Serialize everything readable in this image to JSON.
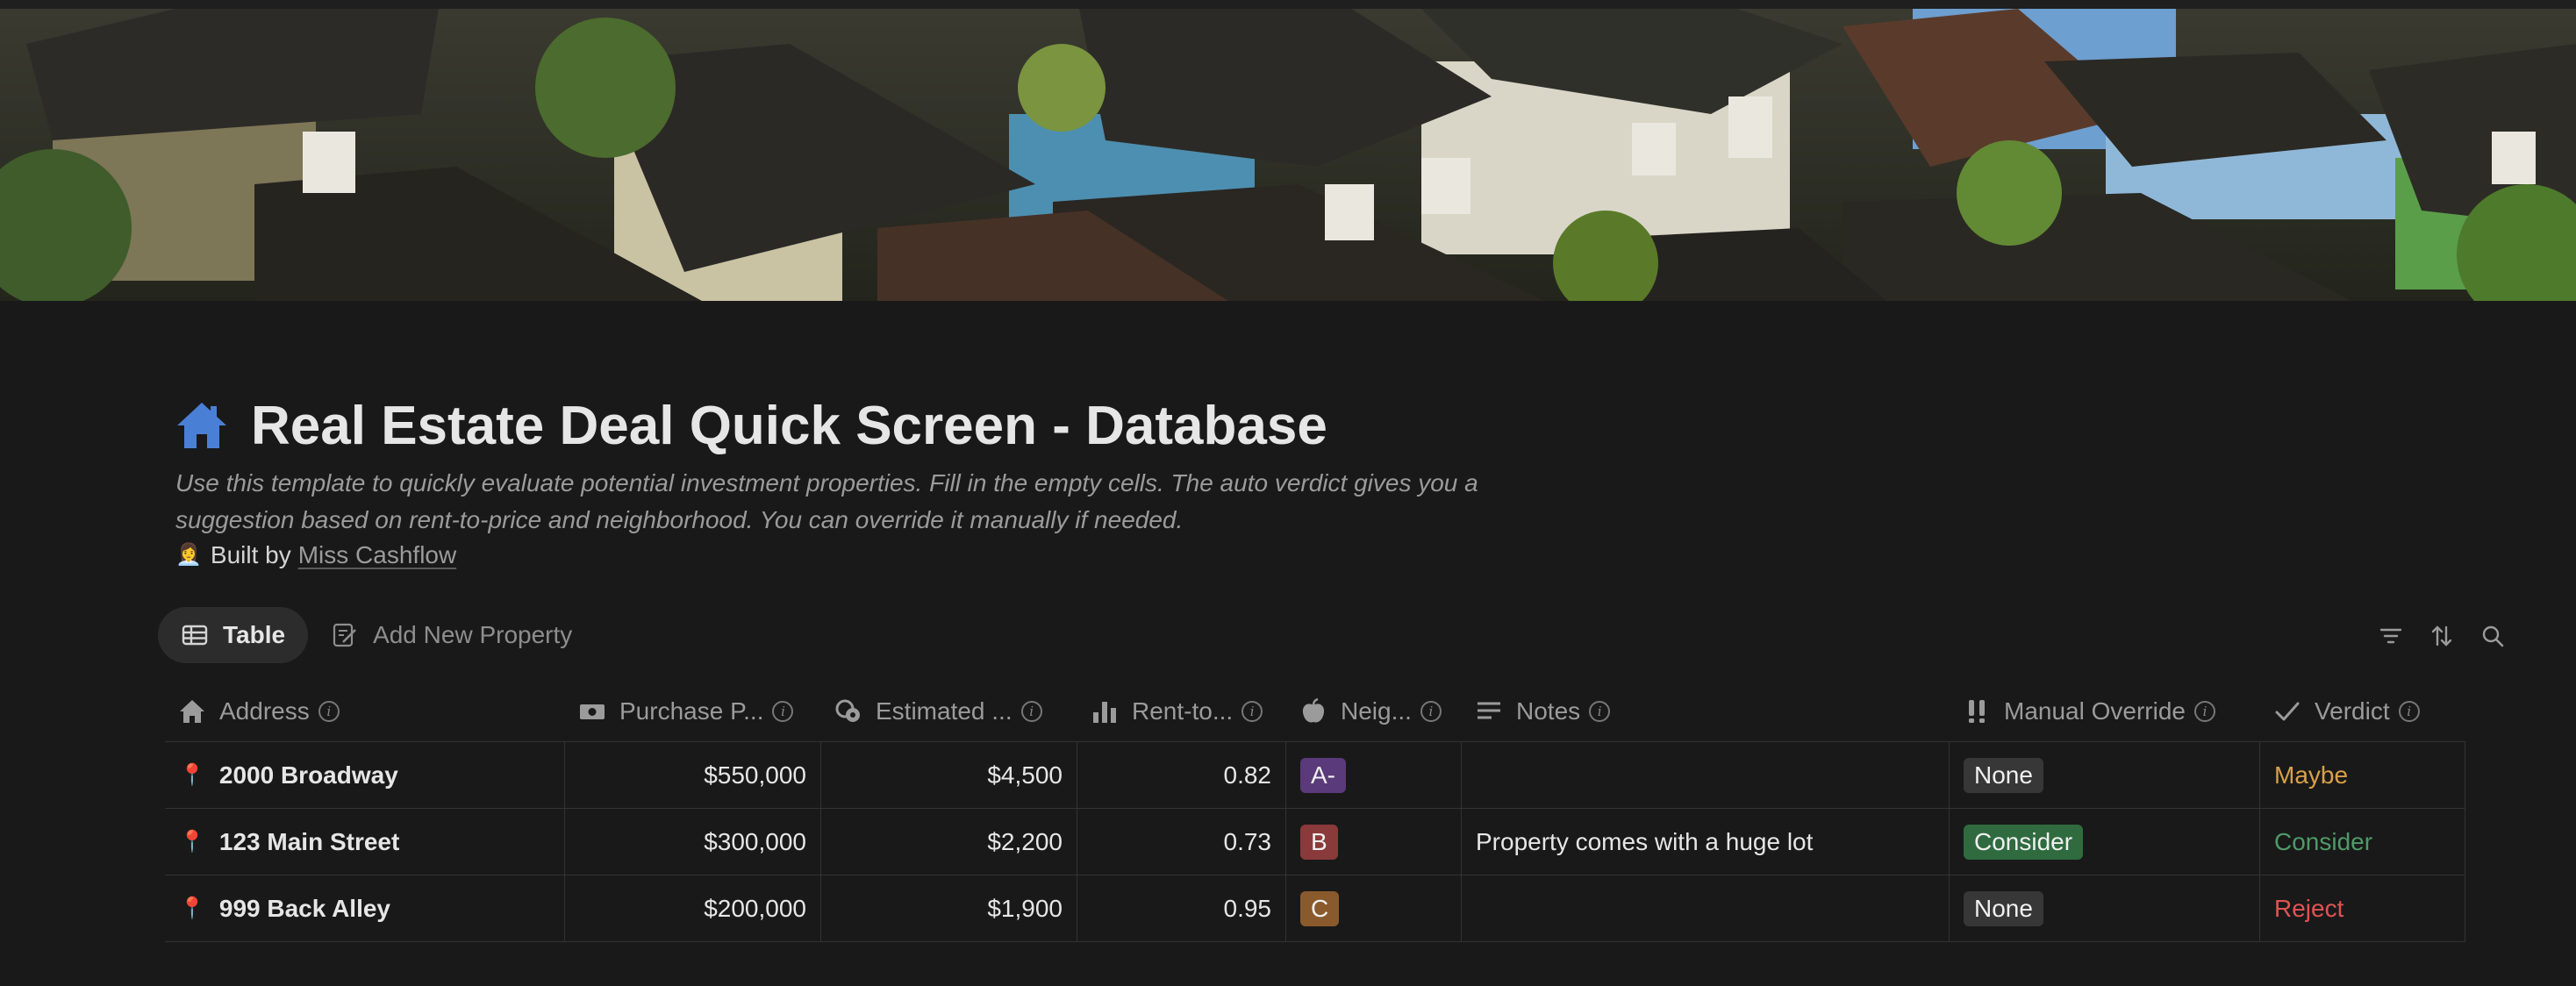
{
  "page": {
    "title": "Real Estate Deal Quick Screen - Database",
    "description": "Use this template to quickly evaluate potential investment properties. Fill in the empty cells. The auto verdict gives you a suggestion based on rent-to-price and neighborhood. You can override it manually if needed.",
    "built_by_prefix": "Built by",
    "built_by_link": "Miss Cashflow",
    "title_icon": "house-icon",
    "built_by_emoji": "👩‍💼"
  },
  "views": {
    "tabs": [
      {
        "label": "Table",
        "icon": "table-icon",
        "active": true
      },
      {
        "label": "Add New Property",
        "icon": "edit-icon",
        "active": false
      }
    ],
    "toolbar": [
      "filter-icon",
      "sort-icon",
      "search-icon"
    ]
  },
  "table": {
    "columns": [
      {
        "label": "Address",
        "icon": "house-icon"
      },
      {
        "label": "Purchase P...",
        "icon": "money-icon"
      },
      {
        "label": "Estimated ...",
        "icon": "coins-icon"
      },
      {
        "label": "Rent-to...",
        "icon": "bar-chart-icon"
      },
      {
        "label": "Neig...",
        "icon": "apple-icon"
      },
      {
        "label": "Notes",
        "icon": "text-lines-icon"
      },
      {
        "label": "Manual Override",
        "icon": "double-exclamation-icon"
      },
      {
        "label": "Verdict",
        "icon": "check-icon"
      }
    ],
    "rows": [
      {
        "address": "2000 Broadway",
        "price": "$550,000",
        "rent": "$4,500",
        "ratio": "0.82",
        "grade": "A-",
        "notes": "",
        "override": "None",
        "verdict": "Maybe"
      },
      {
        "address": "123 Main Street",
        "price": "$300,000",
        "rent": "$2,200",
        "ratio": "0.73",
        "grade": "B",
        "notes": "Property comes with a huge lot",
        "override": "Consider",
        "verdict": "Consider"
      },
      {
        "address": "999 Back Alley",
        "price": "$200,000",
        "rent": "$1,900",
        "ratio": "0.95",
        "grade": "C",
        "notes": "",
        "override": "None",
        "verdict": "Reject"
      }
    ]
  },
  "colors": {
    "background": "#191919",
    "accent_blue": "#4a7fd6",
    "grade_A": "#5a3a7a",
    "grade_B": "#8a3a3a",
    "grade_C": "#8a5a2c",
    "override_none": "#373737",
    "override_consider": "#2f6b3f",
    "verdict_maybe": "#d9a04a",
    "verdict_consider": "#4f9a68",
    "verdict_reject": "#df5452"
  }
}
